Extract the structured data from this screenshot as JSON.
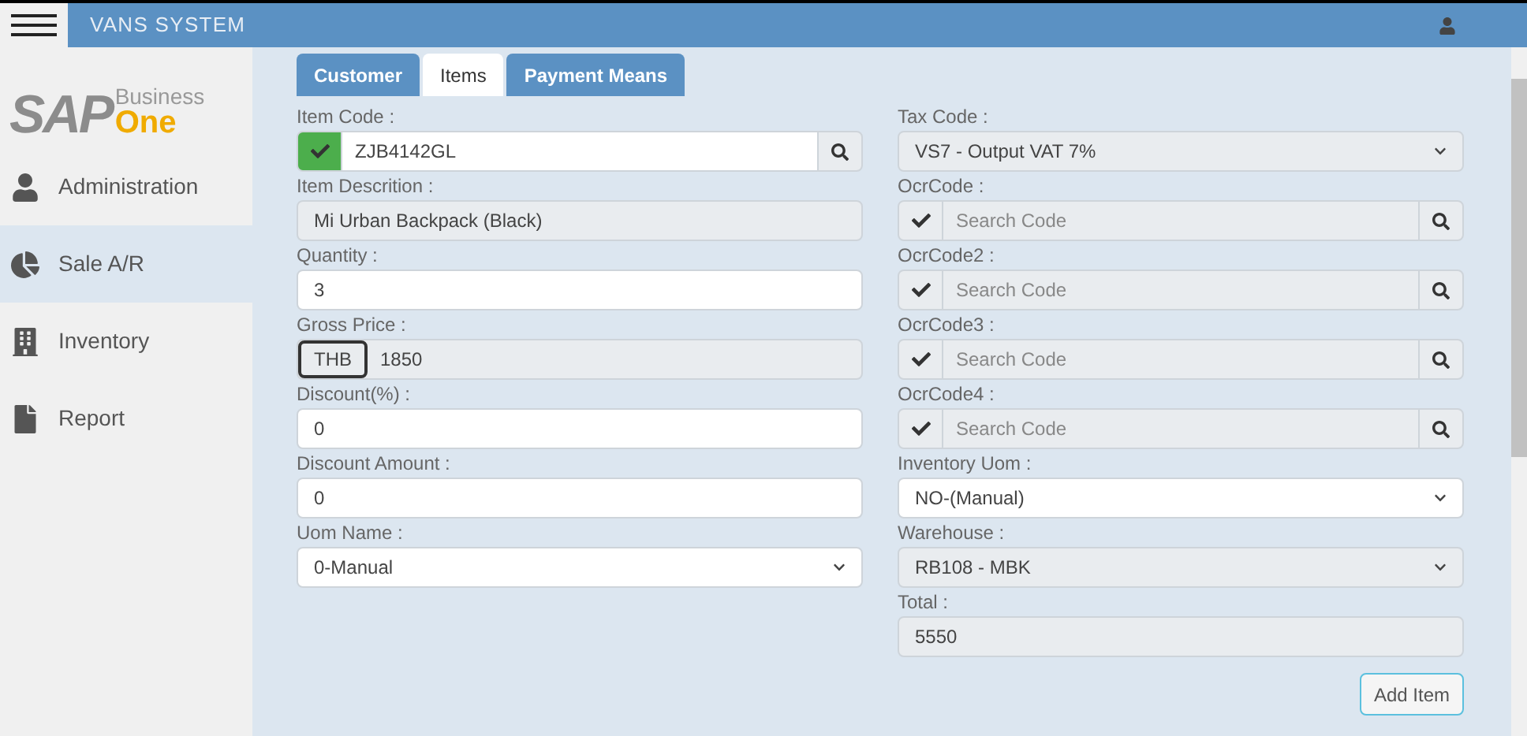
{
  "header": {
    "title": "VANS SYSTEM"
  },
  "logo": {
    "main": "SAP",
    "top": "Business",
    "bottom": "One"
  },
  "sidebar": {
    "items": [
      {
        "label": "Administration",
        "selected": false
      },
      {
        "label": "Sale A/R",
        "selected": true
      },
      {
        "label": "Inventory",
        "selected": false
      },
      {
        "label": "Report",
        "selected": false
      }
    ]
  },
  "tabs": [
    {
      "label": "Customer",
      "selected": false
    },
    {
      "label": "Items",
      "selected": true
    },
    {
      "label": "Payment Means",
      "selected": false
    }
  ],
  "left_fields": [
    {
      "label": "Item Code :",
      "kind": "lookup",
      "value": "ZJB4142GL",
      "color": "#4cae4c",
      "disabled": false
    },
    {
      "label": "Item Descrition :",
      "kind": "input",
      "value": "Mi Urban Backpack (Black)",
      "disabled": true
    },
    {
      "label": "Quantity :",
      "kind": "input",
      "value": "3",
      "disabled": false
    },
    {
      "label": "Gross Price :",
      "kind": "prefixed",
      "prefix": "THB",
      "value": "1850",
      "disabled": true
    },
    {
      "label": "Discount(%) :",
      "kind": "input",
      "value": "0",
      "disabled": false
    },
    {
      "label": "Discount Amount :",
      "kind": "input",
      "value": "0",
      "disabled": false
    },
    {
      "label": "Uom Name :",
      "kind": "select",
      "value": "0-Manual",
      "disabled": false
    }
  ],
  "right_fields": [
    {
      "label": "Tax Code :",
      "kind": "select",
      "value": "VS7 - Output VAT 7%",
      "disabled": true
    },
    {
      "label": "OcrCode :",
      "kind": "lookup",
      "placeholder": "Search Code",
      "color": "#e9ecef",
      "disabled": true
    },
    {
      "label": "OcrCode2 :",
      "kind": "lookup",
      "placeholder": "Search Code",
      "color": "#e9ecef",
      "disabled": true
    },
    {
      "label": "OcrCode3 :",
      "kind": "lookup",
      "placeholder": "Search Code",
      "color": "#e9ecef",
      "disabled": true
    },
    {
      "label": "OcrCode4 :",
      "kind": "lookup",
      "placeholder": "Search Code",
      "color": "#e9ecef",
      "disabled": true
    },
    {
      "label": "Inventory Uom :",
      "kind": "select",
      "value": "NO-(Manual)",
      "disabled": false
    },
    {
      "label": "Warehouse :",
      "kind": "select",
      "value": "RB108 - MBK",
      "disabled": true
    },
    {
      "label": "Total :",
      "kind": "input",
      "value": "5550",
      "disabled": true
    }
  ],
  "add_button": {
    "label": "Add Item"
  }
}
